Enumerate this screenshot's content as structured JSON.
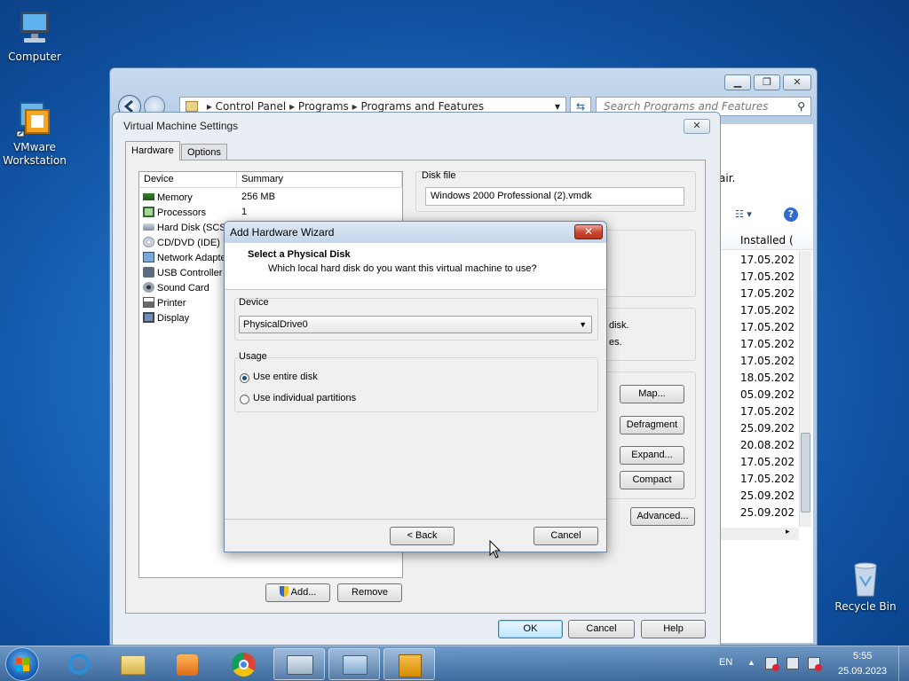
{
  "desktop": {
    "icons": [
      {
        "label": "Computer"
      },
      {
        "label": "VMware Workstation"
      },
      {
        "label": "Recycle Bin"
      }
    ]
  },
  "explorer": {
    "breadcrumb": [
      "Control Panel",
      "Programs",
      "Programs and Features"
    ],
    "search_placeholder": "Search Programs and Features",
    "window_buttons": [
      "minimize",
      "restore",
      "close"
    ],
    "partial_text_1": "air.",
    "column_header": "Installed (",
    "dates": [
      "17.05.202",
      "17.05.202",
      "17.05.202",
      "17.05.202",
      "17.05.202",
      "17.05.202",
      "17.05.202",
      "18.05.202",
      "05.09.202",
      "17.05.202",
      "25.09.202",
      "20.08.202",
      "17.05.202",
      "17.05.202",
      "25.09.202",
      "25.09.202"
    ]
  },
  "vm_settings": {
    "title": "Virtual Machine Settings",
    "tabs": [
      "Hardware",
      "Options"
    ],
    "columns": {
      "device": "Device",
      "summary": "Summary"
    },
    "devices": [
      {
        "name": "Memory",
        "summary": "256 MB"
      },
      {
        "name": "Processors",
        "summary": "1"
      },
      {
        "name": "Hard Disk (SCSI",
        "summary": ""
      },
      {
        "name": "CD/DVD (IDE)",
        "summary": ""
      },
      {
        "name": "Network Adapte",
        "summary": ""
      },
      {
        "name": "USB Controller",
        "summary": ""
      },
      {
        "name": "Sound Card",
        "summary": ""
      },
      {
        "name": "Printer",
        "summary": ""
      },
      {
        "name": "Display",
        "summary": ""
      }
    ],
    "add_label": "Add...",
    "remove_label": "Remove",
    "disk_file_label": "Disk file",
    "disk_file_value": "Windows 2000 Professional (2).vmdk",
    "partial_disk_1": "disk.",
    "partial_disk_2": "es.",
    "map_label": "Map...",
    "defragment_label": "Defragment",
    "expand_label": "Expand...",
    "compact_label": "Compact",
    "advanced_label": "Advanced...",
    "ok_label": "OK",
    "cancel_label": "Cancel",
    "help_label": "Help"
  },
  "wizard": {
    "title": "Add Hardware Wizard",
    "heading": "Select a Physical Disk",
    "subheading": "Which local hard disk do you want this virtual machine to use?",
    "device_label": "Device",
    "device_value": "PhysicalDrive0",
    "usage_label": "Usage",
    "option_entire": "Use entire disk",
    "option_partitions": "Use individual partitions",
    "selected_option": "Use entire disk",
    "back_label": "< Back",
    "cancel_label": "Cancel"
  },
  "taskbar": {
    "language": "EN",
    "time": "5:55",
    "date": "25.09.2023"
  }
}
